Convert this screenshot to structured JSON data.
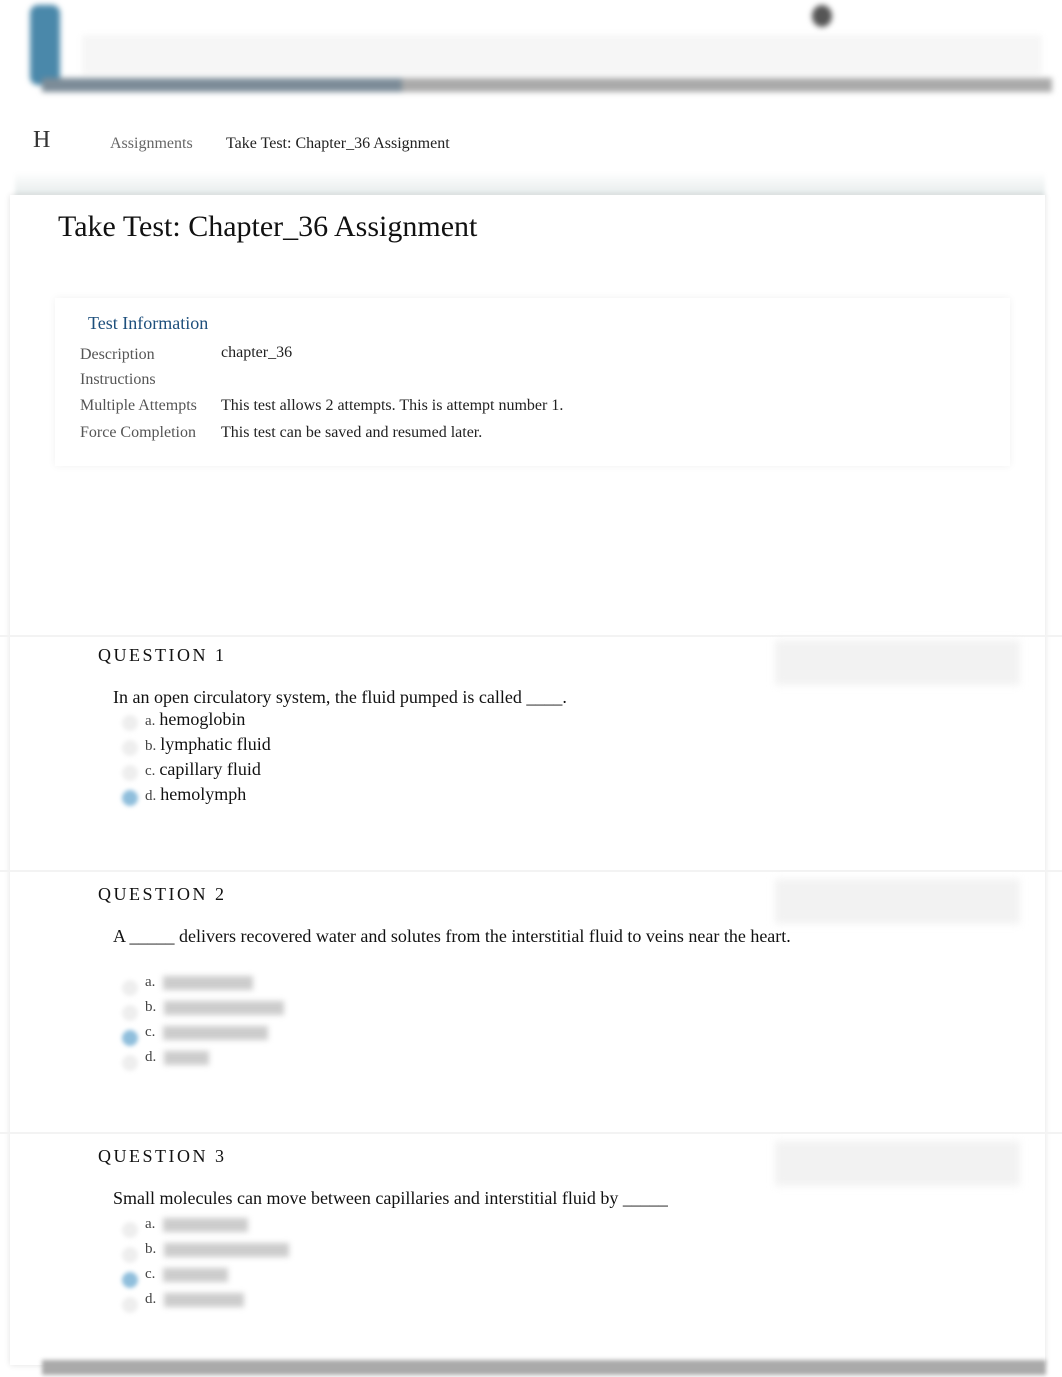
{
  "breadcrumb": {
    "logo": "H",
    "items": [
      "Assignments",
      "Take Test: Chapter_36 Assignment"
    ]
  },
  "page_title": "Take Test: Chapter_36 Assignment",
  "test_info": {
    "title": "Test Information",
    "rows": [
      {
        "label": "Description",
        "value": "chapter_36"
      },
      {
        "label": "Instructions",
        "value": ""
      },
      {
        "label": "Multiple Attempts",
        "value": "This test allows 2 attempts. This is attempt number 1."
      },
      {
        "label": "Force Completion",
        "value": "This test can be saved and resumed later."
      }
    ]
  },
  "questions": [
    {
      "heading": "QUESTION 1",
      "text": "In an open circulatory system, the fluid pumped is called ____.",
      "options": [
        {
          "letter": "a.",
          "text": "hemoglobin"
        },
        {
          "letter": "b.",
          "text": "lymphatic fluid"
        },
        {
          "letter": "c.",
          "text": "capillary fluid"
        },
        {
          "letter": "d.",
          "text": "hemolymph"
        }
      ],
      "selected": "d"
    },
    {
      "heading": "QUESTION 2",
      "text": "A _____ delivers recovered water and solutes from the interstitial fluid to veins near the heart.",
      "options": [
        {
          "letter": "a."
        },
        {
          "letter": "b."
        },
        {
          "letter": "c."
        },
        {
          "letter": "d."
        }
      ],
      "selected": "c"
    },
    {
      "heading": "QUESTION 3",
      "text": "Small molecules can move between capillaries and interstitial fluid by _____",
      "options": [
        {
          "letter": "a."
        },
        {
          "letter": "b."
        },
        {
          "letter": "c."
        },
        {
          "letter": "d."
        }
      ],
      "selected": "c"
    }
  ],
  "colors": {
    "link": "#1d4f7c",
    "selected_radio": "#8fbedc"
  }
}
